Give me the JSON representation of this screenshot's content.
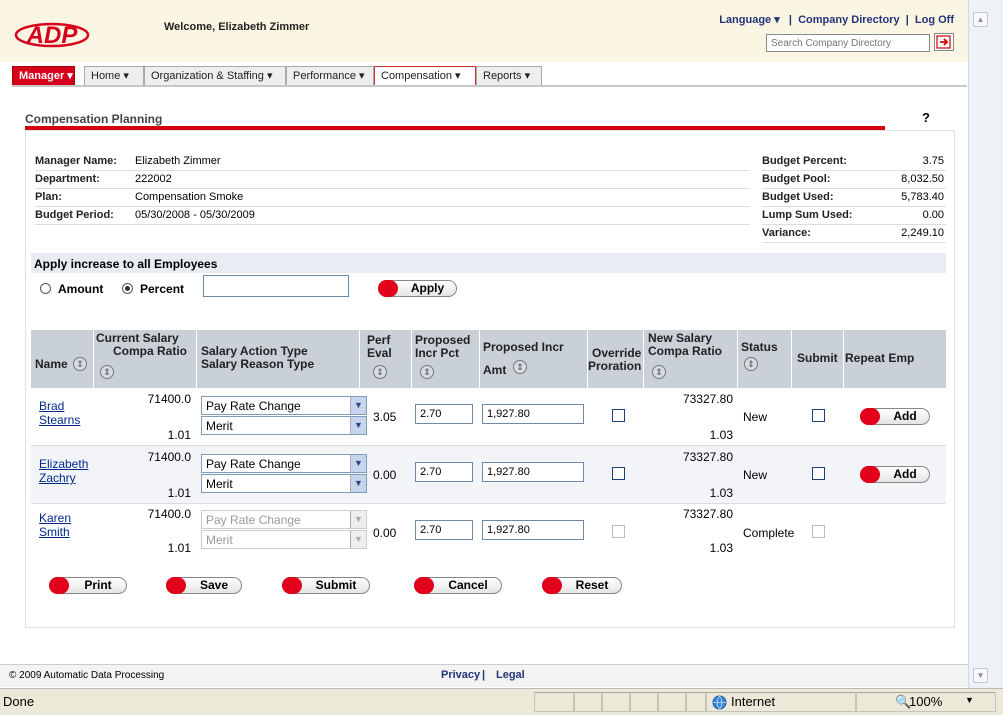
{
  "header": {
    "logo_text": "ADP",
    "welcome": "Welcome, Elizabeth Zimmer",
    "language_link": "Language ▾",
    "company_directory_link": "Company Directory",
    "logoff_link": "Log Off",
    "search_placeholder": "Search Company Directory"
  },
  "nav": [
    {
      "label": "Manager ▾"
    },
    {
      "label": "Home ▾"
    },
    {
      "label": "Organization & Staffing ▾"
    },
    {
      "label": "Performance ▾"
    },
    {
      "label": "Compensation ▾"
    },
    {
      "label": "Reports ▾"
    }
  ],
  "page": {
    "title": "Compensation Planning",
    "help": "?"
  },
  "info": {
    "manager_label": "Manager Name:",
    "manager_value": "Elizabeth Zimmer",
    "department_label": "Department:",
    "department_value": "222002",
    "plan_label": "Plan:",
    "plan_value": "Compensation Smoke",
    "period_label": "Budget Period:",
    "period_value": "05/30/2008 - 05/30/2009",
    "budget_percent_label": "Budget Percent:",
    "budget_percent_value": "3.75",
    "budget_pool_label": "Budget Pool:",
    "budget_pool_value": "8,032.50",
    "budget_used_label": "Budget Used:",
    "budget_used_value": "5,783.40",
    "lump_sum_label": "Lump Sum Used:",
    "lump_sum_value": "0.00",
    "variance_label": "Variance:",
    "variance_value": "2,249.10"
  },
  "apply": {
    "heading": "Apply increase to all Employees",
    "amount_label": "Amount",
    "percent_label": "Percent",
    "selected": "Percent",
    "value": "",
    "button": "Apply"
  },
  "grid": {
    "headers": {
      "name": "Name",
      "compa1": "Current Salary",
      "compa2": "Compa Ratio",
      "action1": "Salary Action Type",
      "action2": "Salary Reason Type",
      "perf1": "Perf",
      "perf2": "Eval",
      "pct1": "Proposed",
      "pct2": "Incr Pct",
      "amt1": "Proposed Incr",
      "amt2": "Amt",
      "override1": "Override",
      "override2": "Proration",
      "newsal1": "New Salary",
      "newsal2": "Compa Ratio",
      "status": "Status",
      "submit": "Submit",
      "repeat": "Repeat Emp"
    },
    "rows": [
      {
        "first": "Brad",
        "last": "Stearns",
        "salary": "71400.0",
        "compa": "1.01",
        "action": "Pay Rate Change",
        "reason": "Merit",
        "perf": "3.05",
        "pct": "2.70",
        "amt": "1,927.80",
        "new_salary": "73327.80",
        "new_compa": "1.03",
        "status": "New",
        "repeat": "Add"
      },
      {
        "first": "Elizabeth",
        "last": "Zachry",
        "salary": "71400.0",
        "compa": "1.01",
        "action": "Pay Rate Change",
        "reason": "Merit",
        "perf": "0.00",
        "pct": "2.70",
        "amt": "1,927.80",
        "new_salary": "73327.80",
        "new_compa": "1.03",
        "status": "New",
        "repeat": "Add"
      },
      {
        "first": "Karen",
        "last": "Smith",
        "salary": "71400.0",
        "compa": "1.01",
        "action": "Pay Rate Change",
        "reason": "Merit",
        "perf": "0.00",
        "pct": "2.70",
        "amt": "1,927.80",
        "new_salary": "73327.80",
        "new_compa": "1.03",
        "status": "Complete",
        "repeat": ""
      }
    ]
  },
  "actions": {
    "print": "Print",
    "save": "Save",
    "submit": "Submit",
    "cancel": "Cancel",
    "reset": "Reset"
  },
  "footer": {
    "copyright": "© 2009 Automatic Data Processing",
    "privacy": "Privacy",
    "legal": "Legal"
  },
  "statusbar": {
    "left": "Done",
    "zone": "Internet",
    "zoom": "100%"
  },
  "colors": {
    "brand_red": "#d6001c",
    "header_bg": "#fbf6e3",
    "grid_header": "#c9d0d7"
  }
}
